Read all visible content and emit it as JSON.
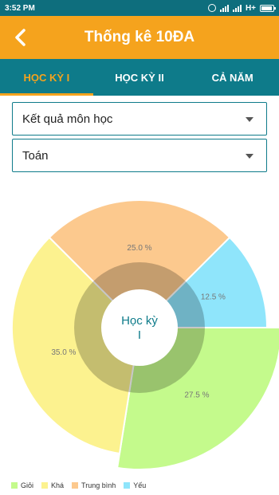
{
  "status_bar": {
    "time": "3:52 PM",
    "network": "H+"
  },
  "app_bar": {
    "title": "Thống kê 10ĐA"
  },
  "tabs": [
    {
      "label": "HỌC KỲ I",
      "active": true
    },
    {
      "label": "HỌC KỲ II",
      "active": false
    },
    {
      "label": "CẢ NĂM",
      "active": false
    }
  ],
  "selects": {
    "report_type": "Kết quả môn học",
    "subject": "Toán"
  },
  "colors": {
    "primary": "#0e7b8a",
    "accent": "#f5a31d"
  },
  "chart_data": {
    "type": "pie",
    "center_label": "Học kỳ I",
    "slices": [
      {
        "label": "Giỏi",
        "value": 27.5,
        "value_label": "27.5 %",
        "color": "#c4fa8c"
      },
      {
        "label": "Khá",
        "value": 35.0,
        "value_label": "35.0 %",
        "color": "#fcf28f"
      },
      {
        "label": "Trung bình",
        "value": 25.0,
        "value_label": "25.0 %",
        "color": "#fcc98e"
      },
      {
        "label": "Yếu",
        "value": 12.5,
        "value_label": "12.5 %",
        "color": "#8fe5fb"
      }
    ],
    "legend": [
      "Giỏi",
      "Khá",
      "Trung bình",
      "Yếu"
    ],
    "legend_placement": "bottom-left"
  }
}
